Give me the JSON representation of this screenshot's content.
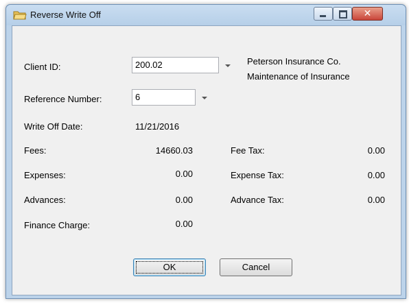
{
  "window": {
    "title": "Reverse Write Off",
    "close_glyph": "✕"
  },
  "client_id": {
    "label": "Client ID:",
    "value": "200.02",
    "client_name": "Peterson Insurance Co.",
    "matter_name": "Maintenance of Insurance"
  },
  "reference": {
    "label": "Reference Number:",
    "value": "6"
  },
  "write_off_date": {
    "label": "Write Off Date:",
    "value": "11/21/2016"
  },
  "amounts": {
    "fees_label": "Fees:",
    "fees_value": "14660.03",
    "expenses_label": "Expenses:",
    "expenses_value": "0.00",
    "advances_label": "Advances:",
    "advances_value": "0.00",
    "finance_label": "Finance Charge:",
    "finance_value": "0.00",
    "fee_tax_label": "Fee Tax:",
    "fee_tax_value": "0.00",
    "expense_tax_label": "Expense Tax:",
    "expense_tax_value": "0.00",
    "advance_tax_label": "Advance Tax:",
    "advance_tax_value": "0.00"
  },
  "buttons": {
    "ok_label": "OK",
    "cancel_label": "Cancel"
  },
  "icons": {
    "app": "folder-icon",
    "minimize": "minimize-icon",
    "maximize": "maximize-icon",
    "close": "close-icon",
    "dropdown": "chevron-down-icon"
  }
}
